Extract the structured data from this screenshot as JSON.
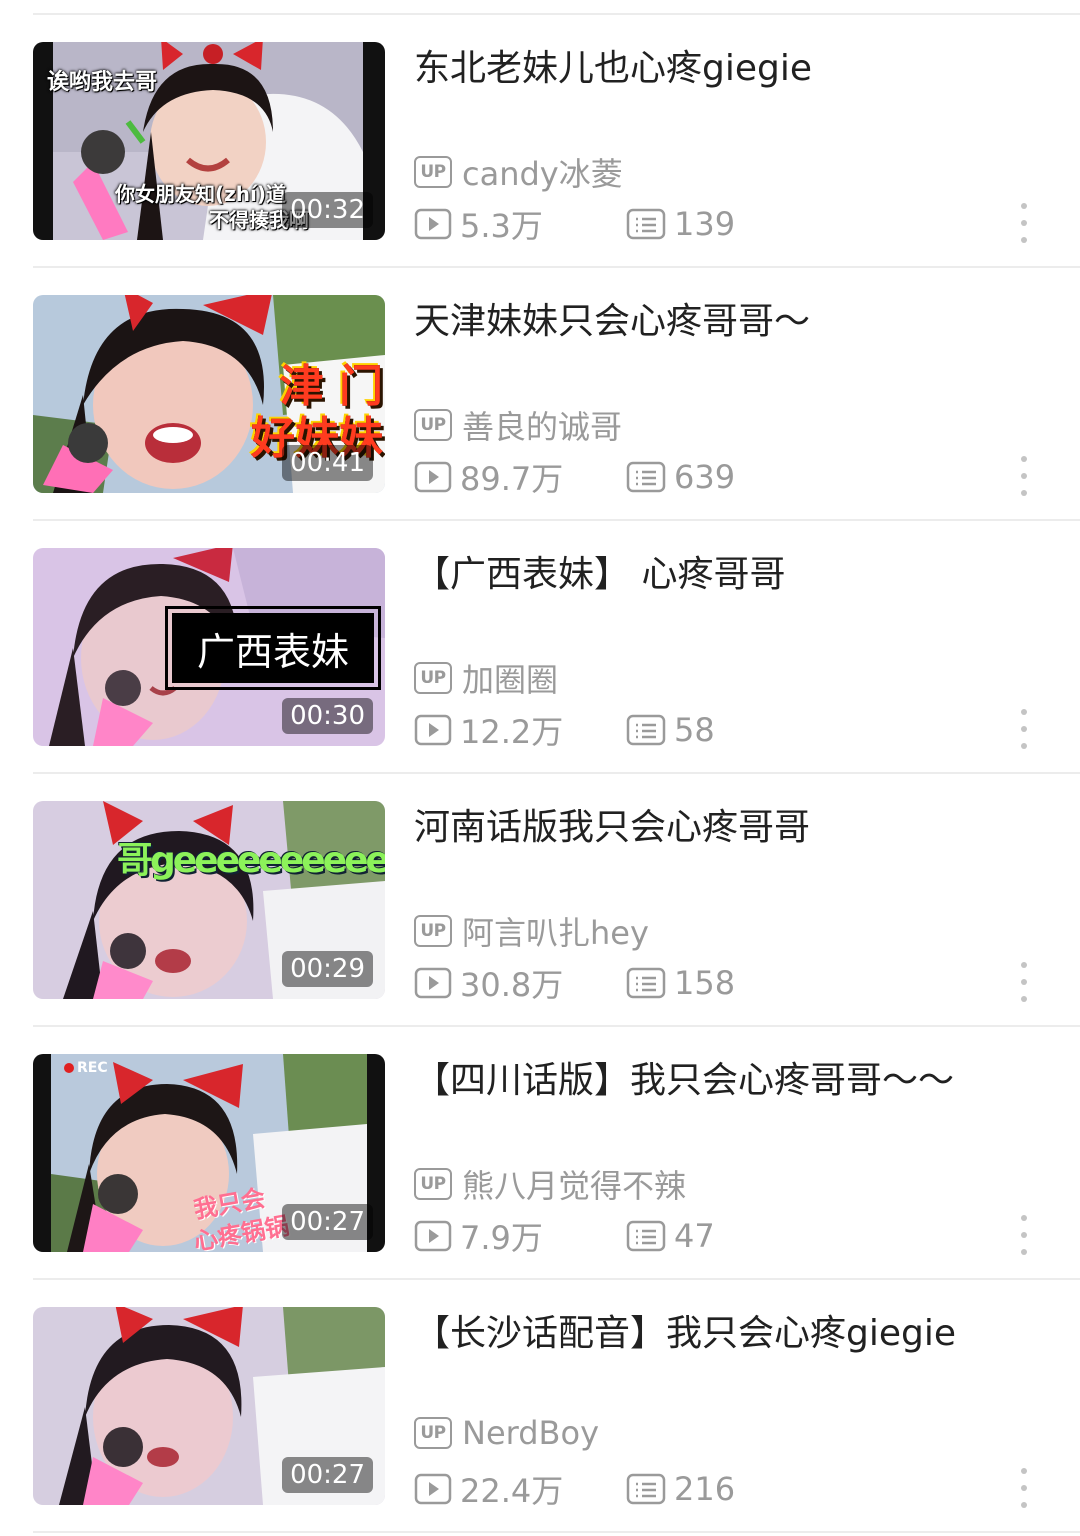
{
  "videos": [
    {
      "title": "东北老妹儿也心疼giegie",
      "uploader": "candy冰菱",
      "views": "5.3万",
      "comments": "139",
      "duration": "00:32",
      "overlay": [
        "诶哟我去哥",
        "你女朋友知(zhí)道",
        "不得揍我啊"
      ]
    },
    {
      "title": "天津妹妹只会心疼哥哥～",
      "uploader": "善良的诚哥",
      "views": "89.7万",
      "comments": "639",
      "duration": "00:41",
      "overlay": [
        "津 门",
        "好妹妹"
      ]
    },
    {
      "title": "【广西表妹】 心疼哥哥",
      "uploader": "加圈圈",
      "views": "12.2万",
      "comments": "58",
      "duration": "00:30",
      "overlay": [
        "广西表妹"
      ]
    },
    {
      "title": "河南话版我只会心疼哥哥",
      "uploader": "阿言叭扎hey",
      "views": "30.8万",
      "comments": "158",
      "duration": "00:29",
      "overlay": [
        "哥geeeeeeeeeeeee"
      ]
    },
    {
      "title": "【四川话版】我只会心疼哥哥～～",
      "uploader": "熊八月觉得不辣",
      "views": "7.9万",
      "comments": "47",
      "duration": "00:27",
      "overlay": [
        "REC",
        "我只会",
        "心疼锅锅"
      ]
    },
    {
      "title": "【长沙话配音】我只会心疼giegie",
      "uploader": "NerdBoy",
      "views": "22.4万",
      "comments": "216",
      "duration": "00:27",
      "overlay": []
    }
  ],
  "labels": {
    "up_badge": "UP"
  },
  "colors": {
    "meta_gray": "#9a9a9a",
    "title_text": "#212121",
    "divider": "#ececec",
    "bow_red": "#d8262c"
  },
  "icons": {
    "play": "play-icon",
    "comment": "comment-icon",
    "more": "more-icon"
  }
}
